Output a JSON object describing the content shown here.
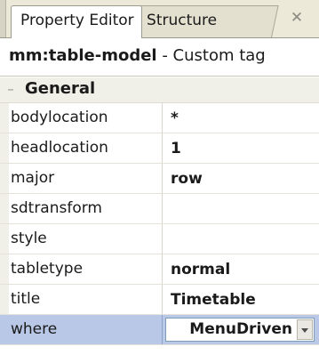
{
  "tabs": [
    {
      "label": "Property Editor",
      "active": true
    },
    {
      "label": "Structure",
      "active": false
    }
  ],
  "close_icon": "close-icon",
  "header": {
    "tag_name": "mm:table-model",
    "tag_suffix": " - Custom tag"
  },
  "category": {
    "label": "General",
    "toggle_icon": "collapse-icon",
    "toggle_glyph": "–"
  },
  "properties": [
    {
      "name": "bodylocation",
      "value": "*"
    },
    {
      "name": "headlocation",
      "value": "1"
    },
    {
      "name": "major",
      "value": "row"
    },
    {
      "name": "sdtransform",
      "value": ""
    },
    {
      "name": "style",
      "value": ""
    },
    {
      "name": "tabletype",
      "value": "normal"
    },
    {
      "name": "title",
      "value": "Timetable"
    },
    {
      "name": "where",
      "value": "MenuDriven",
      "selected": true,
      "editor": "combo-box"
    }
  ],
  "colors": {
    "selection": "#b8c8e6",
    "tab_strip": "#ece9d8",
    "editor_border": "#7f9db9"
  }
}
